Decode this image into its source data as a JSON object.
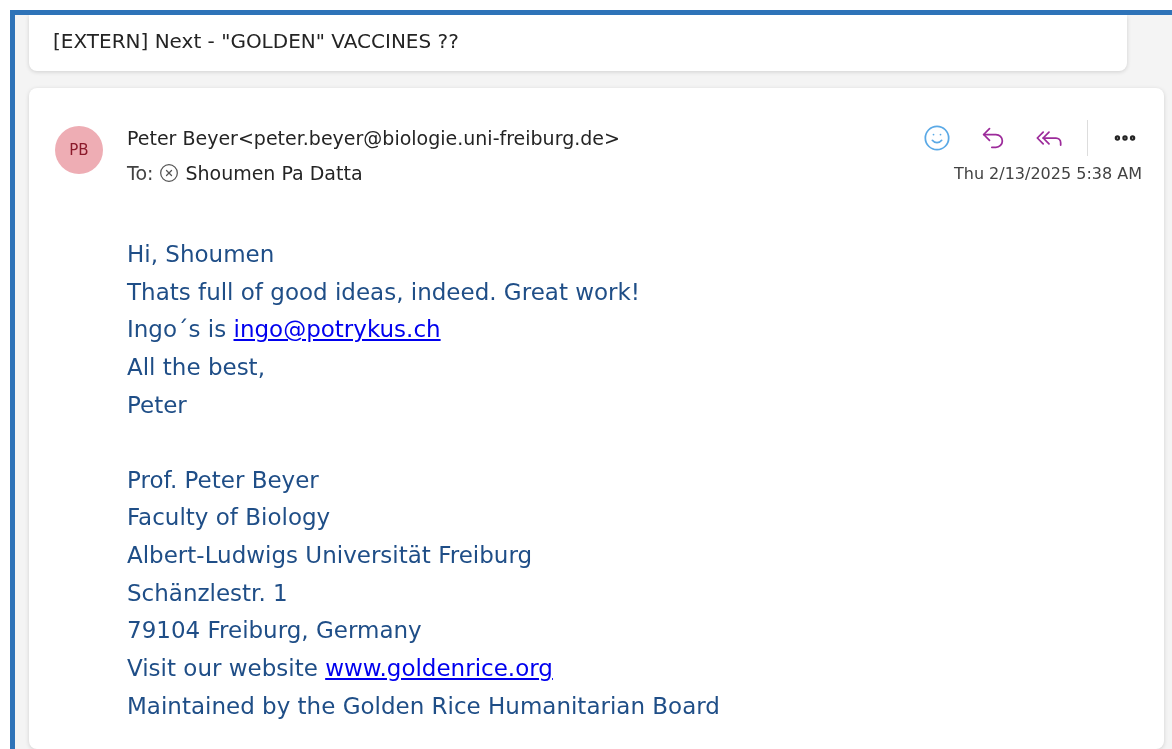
{
  "subject": "[EXTERN] Next - \"GOLDEN\" VACCINES ??",
  "message": {
    "avatar": {
      "initials": "PB",
      "color": "#eeadb4"
    },
    "from": "Peter Beyer<peter.beyer@biologie.uni-freiburg.de>",
    "to_label": "To:",
    "recipient": "Shoumen Pa Datta",
    "date": "Thu 2/13/2025 5:38 AM",
    "paragraphs": [
      [
        {
          "text": "Hi, Shoumen"
        },
        {
          "text": "Thats full of good ideas, indeed. Great work!"
        },
        {
          "text": "Ingo´s is",
          "link": "ingo@potrykus.ch"
        },
        {
          "text": "All the best,"
        },
        {
          "text": "Peter"
        }
      ],
      [
        {
          "text": "Prof. Peter Beyer"
        },
        {
          "text": "Faculty of Biology"
        },
        {
          "text": "Albert-Ludwigs Universität Freiburg"
        },
        {
          "text": "Schänzlestr. 1"
        },
        {
          "text": "79104 Freiburg, Germany"
        },
        {
          "text": "Visit our website",
          "link": "www.goldenrice.org"
        },
        {
          "text": "Maintained by the Golden Rice Humanitarian Board"
        }
      ]
    ]
  }
}
